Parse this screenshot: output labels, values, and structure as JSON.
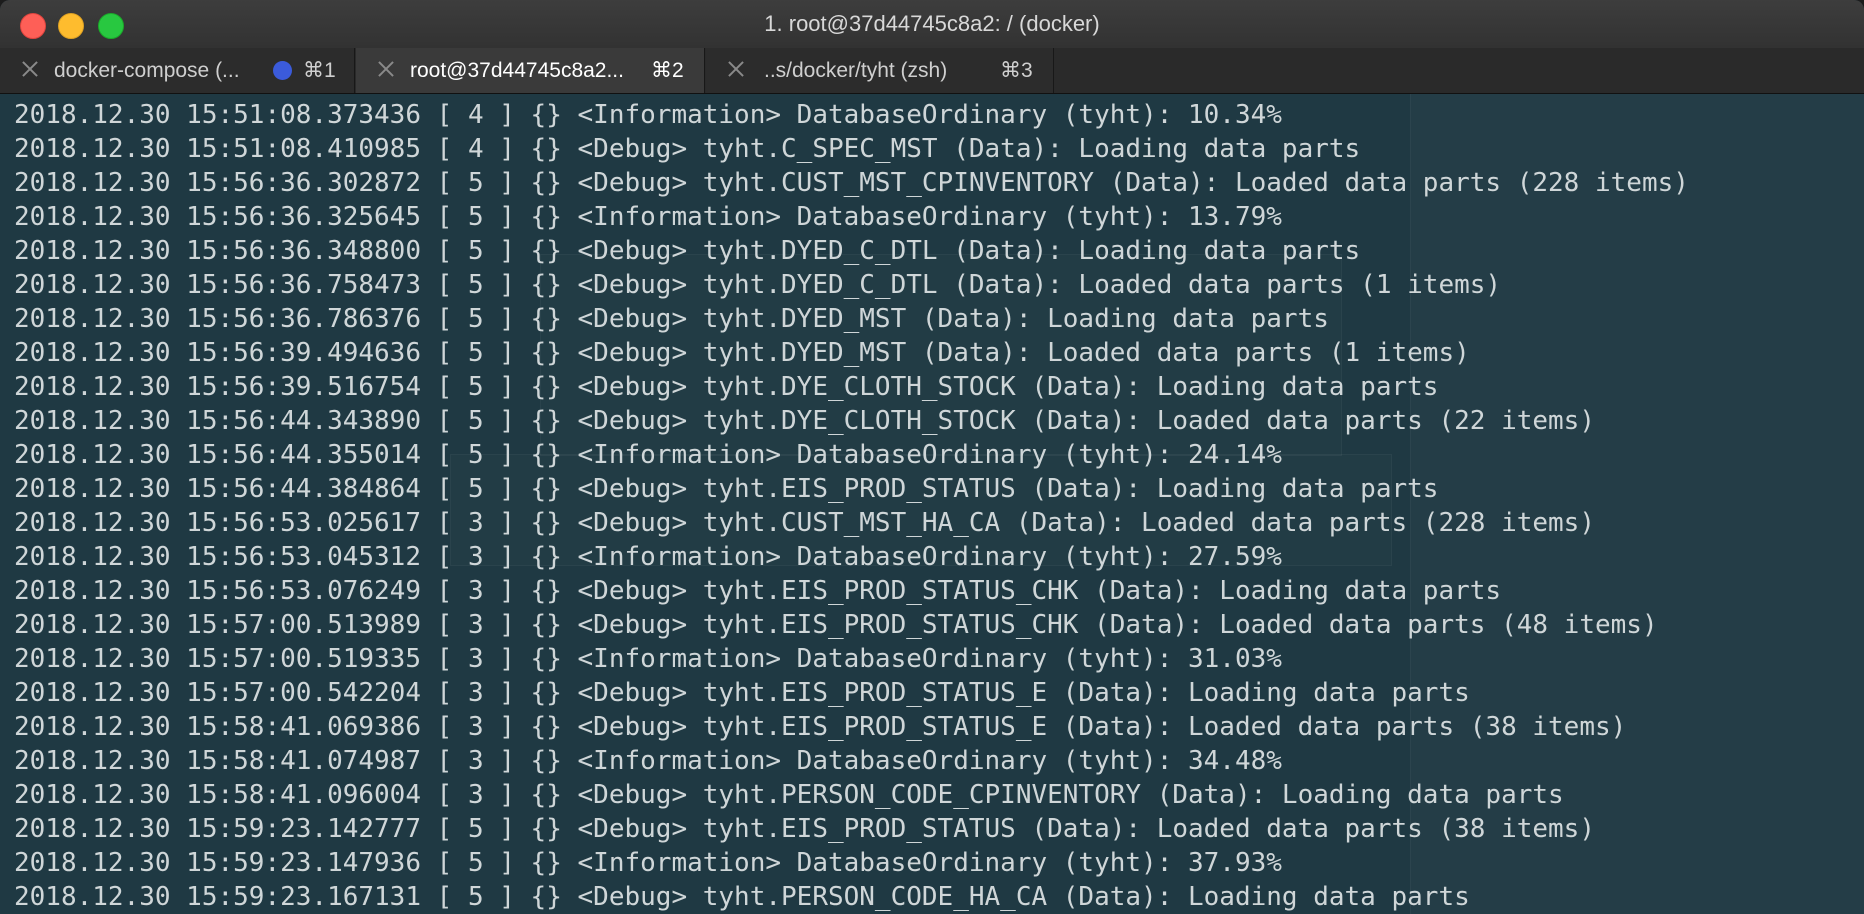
{
  "window": {
    "title": "1. root@37d44745c8a2: / (docker)"
  },
  "tabs": [
    {
      "label": "docker-compose (...",
      "shortcut": "⌘1",
      "active": false,
      "has_activity_dot": true
    },
    {
      "label": "root@37d44745c8a2...",
      "shortcut": "⌘2",
      "active": true,
      "has_activity_dot": false
    },
    {
      "label": "..s/docker/tyht (zsh)",
      "shortcut": "⌘3",
      "active": false,
      "has_activity_dot": false
    }
  ],
  "colors": {
    "terminal_background": "#1f3943",
    "terminal_text": "#cfd6d8",
    "activity_dot": "#3b5bdb",
    "close_button": "#fe5f57",
    "minimize_button": "#febc2e",
    "zoom_button": "#28c840"
  },
  "terminal": {
    "lines": [
      "2018.12.30 15:51:08.373436 [ 4 ] {} <Information> DatabaseOrdinary (tyht): 10.34%",
      "2018.12.30 15:51:08.410985 [ 4 ] {} <Debug> tyht.C_SPEC_MST (Data): Loading data parts",
      "2018.12.30 15:56:36.302872 [ 5 ] {} <Debug> tyht.CUST_MST_CPINVENTORY (Data): Loaded data parts (228 items)",
      "2018.12.30 15:56:36.325645 [ 5 ] {} <Information> DatabaseOrdinary (tyht): 13.79%",
      "2018.12.30 15:56:36.348800 [ 5 ] {} <Debug> tyht.DYED_C_DTL (Data): Loading data parts",
      "2018.12.30 15:56:36.758473 [ 5 ] {} <Debug> tyht.DYED_C_DTL (Data): Loaded data parts (1 items)",
      "2018.12.30 15:56:36.786376 [ 5 ] {} <Debug> tyht.DYED_MST (Data): Loading data parts",
      "2018.12.30 15:56:39.494636 [ 5 ] {} <Debug> tyht.DYED_MST (Data): Loaded data parts (1 items)",
      "2018.12.30 15:56:39.516754 [ 5 ] {} <Debug> tyht.DYE_CLOTH_STOCK (Data): Loading data parts",
      "2018.12.30 15:56:44.343890 [ 5 ] {} <Debug> tyht.DYE_CLOTH_STOCK (Data): Loaded data parts (22 items)",
      "2018.12.30 15:56:44.355014 [ 5 ] {} <Information> DatabaseOrdinary (tyht): 24.14%",
      "2018.12.30 15:56:44.384864 [ 5 ] {} <Debug> tyht.EIS_PROD_STATUS (Data): Loading data parts",
      "2018.12.30 15:56:53.025617 [ 3 ] {} <Debug> tyht.CUST_MST_HA_CA (Data): Loaded data parts (228 items)",
      "2018.12.30 15:56:53.045312 [ 3 ] {} <Information> DatabaseOrdinary (tyht): 27.59%",
      "2018.12.30 15:56:53.076249 [ 3 ] {} <Debug> tyht.EIS_PROD_STATUS_CHK (Data): Loading data parts",
      "2018.12.30 15:57:00.513989 [ 3 ] {} <Debug> tyht.EIS_PROD_STATUS_CHK (Data): Loaded data parts (48 items)",
      "2018.12.30 15:57:00.519335 [ 3 ] {} <Information> DatabaseOrdinary (tyht): 31.03%",
      "2018.12.30 15:57:00.542204 [ 3 ] {} <Debug> tyht.EIS_PROD_STATUS_E (Data): Loading data parts",
      "2018.12.30 15:58:41.069386 [ 3 ] {} <Debug> tyht.EIS_PROD_STATUS_E (Data): Loaded data parts (38 items)",
      "2018.12.30 15:58:41.074987 [ 3 ] {} <Information> DatabaseOrdinary (tyht): 34.48%",
      "2018.12.30 15:58:41.096004 [ 3 ] {} <Debug> tyht.PERSON_CODE_CPINVENTORY (Data): Loading data parts",
      "2018.12.30 15:59:23.142777 [ 5 ] {} <Debug> tyht.EIS_PROD_STATUS (Data): Loaded data parts (38 items)",
      "2018.12.30 15:59:23.147936 [ 5 ] {} <Information> DatabaseOrdinary (tyht): 37.93%",
      "2018.12.30 15:59:23.167131 [ 5 ] {} <Debug> tyht.PERSON_CODE_HA_CA (Data): Loading data parts"
    ]
  }
}
